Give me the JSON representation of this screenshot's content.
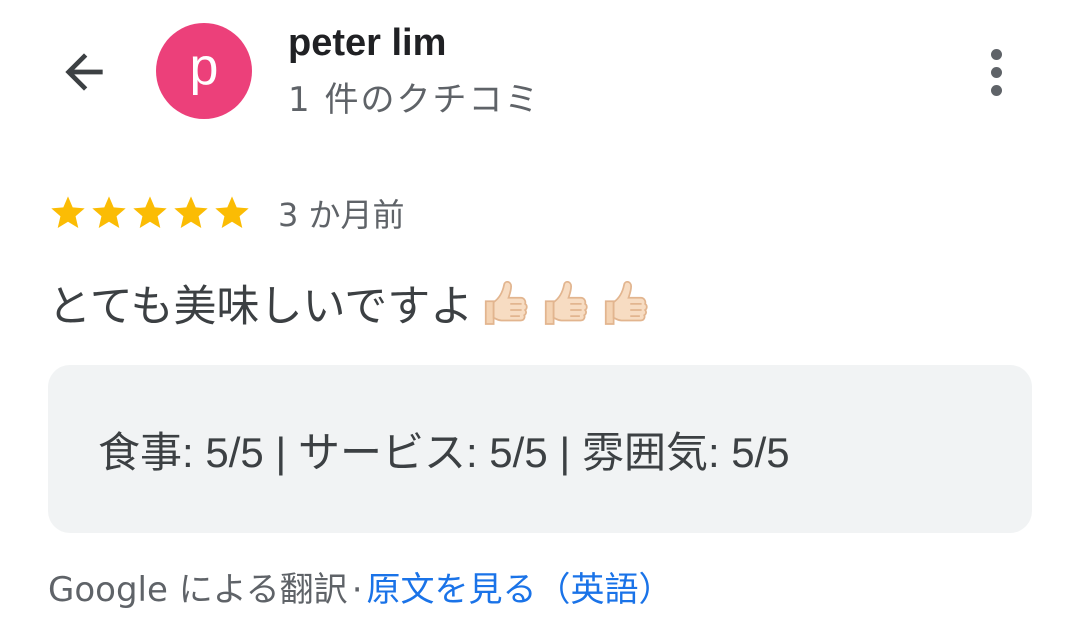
{
  "header": {
    "back_icon": "arrow-back-icon",
    "avatar_letter": "p",
    "avatar_color": "#EC407A",
    "user_name": "peter lim",
    "review_count": "1 件のクチコミ",
    "more_icon": "more-vertical-icon"
  },
  "review": {
    "rating": 5,
    "max_rating": 5,
    "star_color": "#FBBC04",
    "time_ago": "3 か月前",
    "text": "とても美味しいですよ",
    "emojis": [
      "thumbs-up-icon",
      "thumbs-up-icon",
      "thumbs-up-icon"
    ],
    "sub_ratings": "食事: 5/5  |  サービス: 5/5  |  雰囲気: 5/5"
  },
  "translation": {
    "note": "Google による翻訳",
    "separator": "·",
    "original_link": "原文を見る（英語）",
    "link_color": "#1a73e8"
  }
}
